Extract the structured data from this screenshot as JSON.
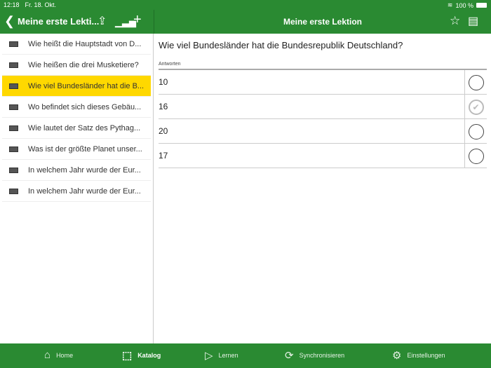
{
  "status": {
    "time": "12:18",
    "date": "Fr. 18. Okt.",
    "battery": "100 %"
  },
  "left_header": {
    "title": "Meine erste Lekti..."
  },
  "right_header": {
    "title": "Meine erste Lektion"
  },
  "questions": [
    "Wie heißt die Hauptstadt von D...",
    "Wie heißen die drei Musketiere?",
    "Wie viel Bundesländer hat die B...",
    "Wo befindet sich dieses Gebäu...",
    "Wie lautet der Satz des Pythag...",
    "Was ist der größte Planet unser...",
    "In welchem Jahr wurde der Eur...",
    "In welchem Jahr wurde der Eur..."
  ],
  "selected_index": 2,
  "detail": {
    "question": "Wie viel Bundesländer hat die Bundesrepublik Deutschland?",
    "answers_label": "Antworten",
    "answers": [
      {
        "text": "10",
        "checked": false
      },
      {
        "text": "16",
        "checked": true
      },
      {
        "text": "20",
        "checked": false
      },
      {
        "text": "17",
        "checked": false
      }
    ]
  },
  "tabs": [
    "Home",
    "Katalog",
    "Lernen",
    "Synchronisieren",
    "Einstellungen"
  ],
  "colors": {
    "brand": "#2a8a32",
    "selection": "#ffd800"
  }
}
